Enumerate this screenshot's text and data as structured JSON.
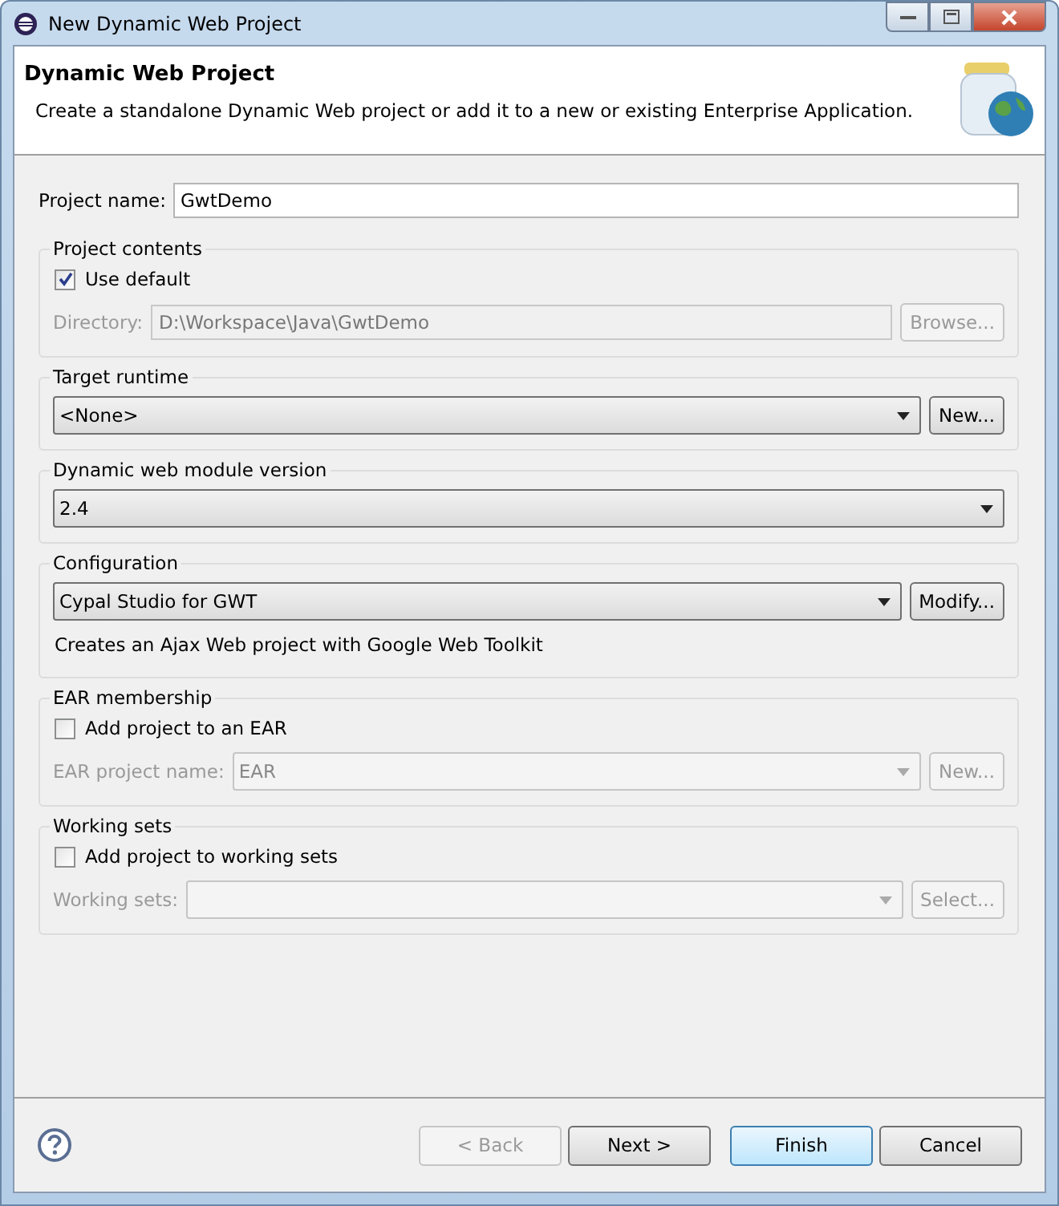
{
  "window": {
    "title": "New Dynamic Web Project"
  },
  "header": {
    "title": "Dynamic Web Project",
    "description": "Create a standalone Dynamic Web project or add it to a new or existing Enterprise Application."
  },
  "project_name": {
    "label": "Project name:",
    "value": "GwtDemo"
  },
  "groups": [
    {
      "title": "Project contents",
      "rows": [
        {
          "kind": "checkbox",
          "label": "Use default",
          "checked": true
        },
        {
          "kind": "field",
          "label": "Directory:",
          "value": "D:\\Workspace\\Java\\GwtDemo",
          "disabled": true,
          "button": {
            "label": "Browse...",
            "disabled": true
          }
        }
      ]
    },
    {
      "title": "Target runtime",
      "rows": [
        {
          "kind": "combo",
          "value": "<None>",
          "disabled": false,
          "button": {
            "label": "New...",
            "disabled": false
          }
        }
      ]
    },
    {
      "title": "Dynamic web module version",
      "rows": [
        {
          "kind": "combo",
          "value": "2.4",
          "disabled": false
        }
      ]
    },
    {
      "title": "Configuration",
      "rows": [
        {
          "kind": "combo",
          "value": "Cypal Studio for GWT",
          "disabled": false,
          "button": {
            "label": "Modify...",
            "disabled": false
          }
        },
        {
          "kind": "note",
          "text": "Creates an Ajax Web project with Google Web Toolkit"
        }
      ]
    },
    {
      "title": "EAR membership",
      "rows": [
        {
          "kind": "checkbox",
          "label": "Add project to an EAR",
          "checked": false
        },
        {
          "kind": "combo",
          "label": "EAR project name:",
          "value": "EAR",
          "disabled": true,
          "button": {
            "label": "New...",
            "disabled": true
          }
        }
      ]
    },
    {
      "title": "Working sets",
      "rows": [
        {
          "kind": "checkbox",
          "label": "Add project to working sets",
          "checked": false
        },
        {
          "kind": "combo",
          "label": "Working sets:",
          "value": "",
          "disabled": true,
          "button": {
            "label": "Select...",
            "disabled": true
          }
        }
      ]
    }
  ],
  "buttons": [
    {
      "label": "< Back",
      "disabled": true,
      "default": false
    },
    {
      "label": "Next >",
      "disabled": false,
      "default": false
    },
    {
      "label": "Finish",
      "disabled": false,
      "default": true
    },
    {
      "label": "Cancel",
      "disabled": false,
      "default": false
    }
  ]
}
